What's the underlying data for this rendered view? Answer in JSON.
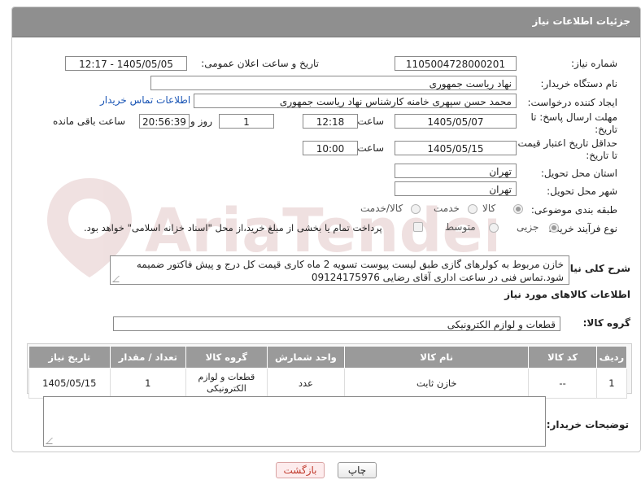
{
  "header": {
    "title": "جزئیات اطلاعات نیاز"
  },
  "form": {
    "need_number_label": "شماره نیاز:",
    "need_number": "1105004728000201",
    "announce_label": "تاریخ و ساعت اعلان عمومی:",
    "announce_value": "1405/05/05 - 12:17",
    "buyer_org_label": "نام دستگاه خریدار:",
    "buyer_org": "نهاد ریاست جمهوری",
    "requester_label": "ایجاد کننده درخواست:",
    "requester": "محمد حسن سپهری خامنه کارشناس نهاد ریاست جمهوری",
    "buyer_contact_link": "اطلاعات تماس خریدار",
    "reply_deadline_label_1": "مهلت ارسال پاسخ: تا",
    "reply_deadline_label_2": "تاریخ:",
    "reply_date": "1405/05/07",
    "time_label": "ساعت",
    "reply_time": "12:18",
    "days_value": "1",
    "days_label": "روز و",
    "remaining_time": "20:56:39",
    "remaining_label": "ساعت باقی مانده",
    "price_validity_label_1": "حداقل تاریخ اعتبار قیمت:",
    "price_validity_label_2": "تا تاریخ:",
    "price_date": "1405/05/15",
    "price_time": "10:00",
    "province_label": "استان محل تحویل:",
    "province": "تهران",
    "city_label": "شهر محل تحویل:",
    "city": "تهران",
    "category_label": "طبقه بندی موضوعی:",
    "category_options": [
      "کالا",
      "خدمت",
      "کالا/خدمت"
    ],
    "purchase_type_label": "نوع فرآیند خرید :",
    "purchase_options": [
      "جزیی",
      "متوسط"
    ],
    "payment_note": "پرداخت تمام یا بخشی از مبلغ خرید،از محل \"اسناد خزانه اسلامی\" خواهد بود."
  },
  "description": {
    "label": "شرح کلی نیاز:",
    "text": "خازن مربوط به کولرهای گازی طبق لیست پیوست تسویه 2 ماه کاری قیمت کل درج و پیش فاکتور ضمیمه شود.تماس فنی در ساعت اداری آقای رضایی 09124175976"
  },
  "goods_section": {
    "title": "اطلاعات کالاهای مورد نیاز",
    "group_label": "گروه کالا:",
    "group_value": "قطعات و لوازم الکترونیکی"
  },
  "table": {
    "headers": [
      "ردیف",
      "کد کالا",
      "نام کالا",
      "واحد شمارش",
      "گروه کالا",
      "تعداد / مقدار",
      "تاریخ نیاز"
    ],
    "rows": [
      [
        "1",
        "--",
        "خازن ثابت",
        "عدد",
        "قطعات و لوازم الکترونیکی",
        "1",
        "1405/05/15"
      ]
    ]
  },
  "buyer_notes": {
    "label": "توضیحات خریدار:",
    "text": ""
  },
  "buttons": {
    "print": "چاپ",
    "back": "بازگشت"
  },
  "watermark": {
    "text": "AriaTender.net"
  },
  "colors": {
    "header_bg": "#8f8f8f",
    "link": "#1a55b5",
    "back_text": "#c0392b"
  }
}
